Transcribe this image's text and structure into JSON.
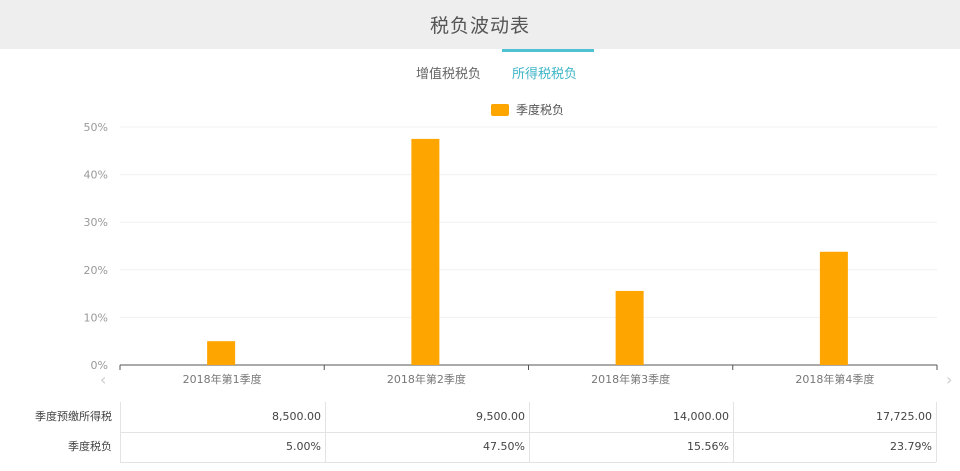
{
  "header": {
    "title": "税负波动表"
  },
  "tabs": [
    {
      "label": "增值税税负",
      "active": false
    },
    {
      "label": "所得税税负",
      "active": true
    }
  ],
  "chart_data": {
    "type": "bar",
    "categories": [
      "2018年第1季度",
      "2018年第2季度",
      "2018年第3季度",
      "2018年第4季度"
    ],
    "series": [
      {
        "name": "季度税负",
        "values": [
          5.0,
          47.5,
          15.56,
          23.79
        ],
        "color": "#ffa500"
      }
    ],
    "yticks": [
      "0%",
      "10%",
      "20%",
      "30%",
      "40%",
      "50%"
    ],
    "ylim": [
      0,
      50
    ],
    "legend_position": "top-center",
    "grid": true
  },
  "table": {
    "rows": [
      {
        "label": "季度预缴所得税",
        "values": [
          "8,500.00",
          "9,500.00",
          "14,000.00",
          "17,725.00"
        ]
      },
      {
        "label": "季度税负",
        "values": [
          "5.00%",
          "47.50%",
          "15.56%",
          "23.79%"
        ]
      }
    ]
  },
  "nav": {
    "prev": "‹",
    "next": "›"
  }
}
